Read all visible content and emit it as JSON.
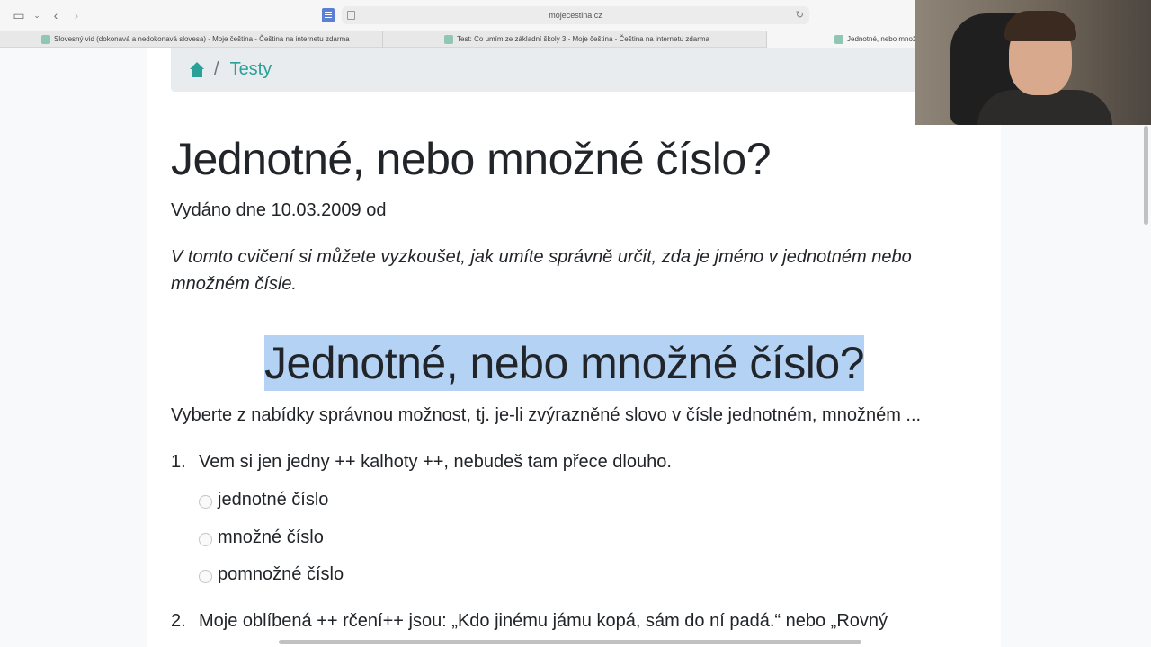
{
  "browser": {
    "url": "mojecestina.cz",
    "tabs": [
      {
        "label": "Slovesný vid (dokonavá a nedokonavá slovesa) - Moje čeština - Čeština na internetu zdarma",
        "active": false
      },
      {
        "label": "Test: Co umím ze základní školy 3 - Moje čeština - Čeština na internetu zdarma",
        "active": false
      },
      {
        "label": "Jednotné, nebo množ…",
        "active": true
      }
    ]
  },
  "breadcrumb": {
    "separator": "/",
    "current": "Testy"
  },
  "article": {
    "title": "Jednotné, nebo množné číslo?",
    "meta": "Vydáno dne 10.03.2009 od",
    "lead": "V tomto cvičení si můžete vyzkoušet, jak umíte správně určit, zda je jméno v jednotném nebo množném čísle.",
    "quiz_title": "Jednotné, nebo množné číslo?",
    "instructions": "Vyberte z nabídky správnou možnost, tj. je-li zvýrazněné slovo v čísle jednotném, množném ...",
    "questions": [
      {
        "number": "1.",
        "text": "Vem si jen jedny ++ kalhoty ++, nebudeš tam přece dlouho.",
        "options": [
          "jednotné číslo",
          "množné číslo",
          "pomnožné číslo"
        ]
      },
      {
        "number": "2.",
        "text": "Moje oblíbená ++ rčení++ jsou: „Kdo jinému jámu kopá, sám do ní padá.“ nebo „Rovný"
      }
    ]
  },
  "colors": {
    "accent": "#2aa198",
    "selection": "#b4d2f4"
  }
}
